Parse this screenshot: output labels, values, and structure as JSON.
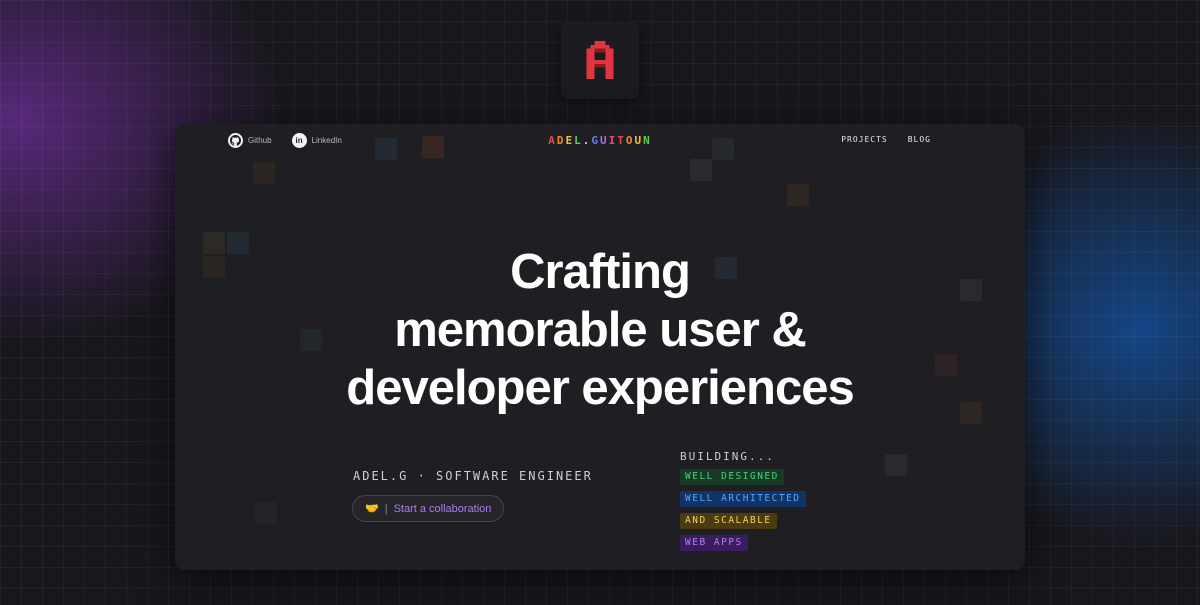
{
  "logo": {
    "letter": "A",
    "color": "#e0363f"
  },
  "nav": {
    "github_label": "Github",
    "linkedin_label": "LinkedIn",
    "linkedin_glyph": "in",
    "brand": "ADEL.GUITOUN",
    "brand_colors": [
      "#e84a4a",
      "#f08a2b",
      "#f2c12e",
      "#5fcf60",
      "#3fb0e8",
      "#6a7cf0",
      "#b06ae8",
      "#e84a8c",
      "#e84a4a",
      "#f08a2b",
      "#f2c12e",
      "#5fcf60"
    ],
    "projects_label": "PROJECTS",
    "blog_label": "BLOG"
  },
  "hero": {
    "line1": "Crafting",
    "line2": "memorable user &",
    "line3": "developer experiences"
  },
  "intro": {
    "role": "ADEL.G · SOFTWARE ENGINEER",
    "collab_emoji": "🤝",
    "collab_sep": "|",
    "collab_label": "Start a collaboration"
  },
  "building": {
    "title": "BUILDING...",
    "tags": [
      {
        "label": "WELL DESIGNED",
        "fg": "#4fd07e",
        "bg": "#163a25"
      },
      {
        "label": "WELL ARCHITECTED",
        "fg": "#52a7ff",
        "bg": "#123363"
      },
      {
        "label": "AND SCALABLE",
        "fg": "#f1d46a",
        "bg": "#4a3b10"
      },
      {
        "label": "WEB APPS",
        "fg": "#b77cf2",
        "bg": "#3a1d5c"
      }
    ]
  }
}
